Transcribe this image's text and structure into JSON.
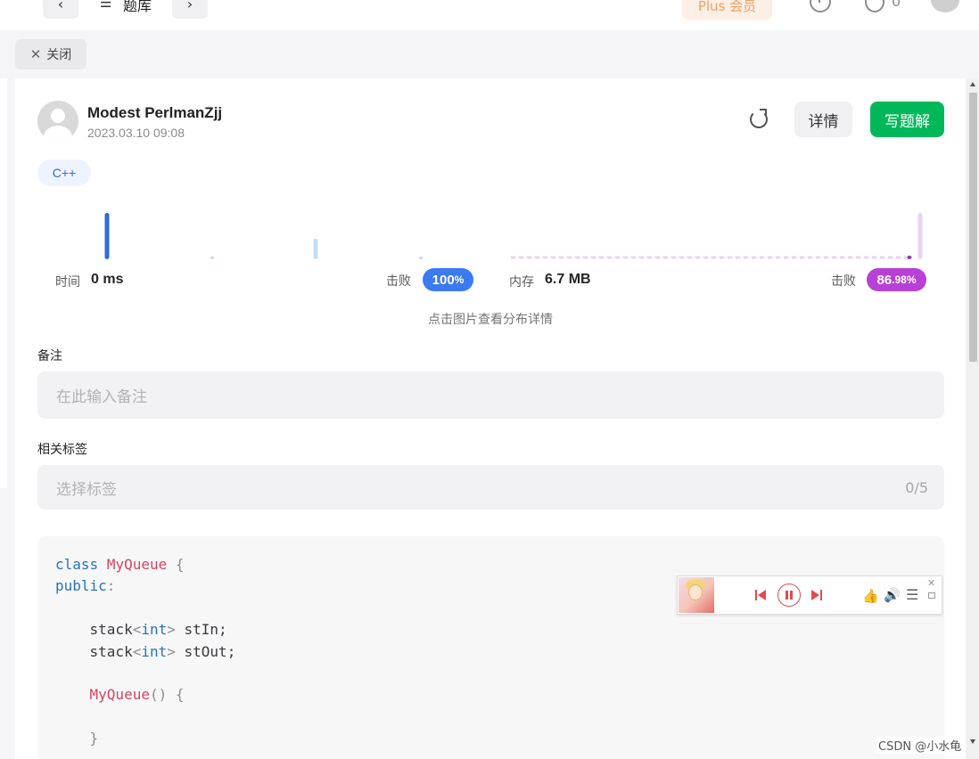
{
  "topbar": {
    "library_label": "题库",
    "prev_glyph": "‹",
    "next_glyph": "›",
    "list_glyph": "☰",
    "plus_label": "Plus 会员",
    "streak_count": "0"
  },
  "close_button": {
    "label": "关闭",
    "glyph": "✕"
  },
  "solution": {
    "author": "Modest PerlmanZjj",
    "date": "2023.03.10 09:08",
    "detail_label": "详情",
    "write_label": "写题解",
    "language_tag": "C++"
  },
  "stats": {
    "time_label": "时间",
    "time_value": "0 ms",
    "time_beat_label": "击败",
    "time_beat_value": "100",
    "time_beat_unit": "%",
    "memory_label": "内存",
    "memory_value": "6.7 MB",
    "memory_beat_label": "击败",
    "memory_beat_int": "86",
    "memory_beat_frac": ".98%",
    "hint": "点击图片查看分布详情"
  },
  "chart_data": [
    {
      "type": "bar",
      "categories": [
        "0",
        "1",
        "2",
        "3"
      ],
      "values": [
        100,
        4,
        45,
        4
      ],
      "highlight_index": 0,
      "colors": {
        "highlight": "#2f6be0",
        "other": "#c9dcf7"
      }
    },
    {
      "type": "bar",
      "categories": [
        "0",
        "1"
      ],
      "values": [
        100,
        8
      ],
      "highlight_index": 1,
      "colors": {
        "highlight": "#8e3bb5",
        "other": "#ead3f7"
      }
    }
  ],
  "notes": {
    "label": "备注",
    "placeholder": "在此输入备注"
  },
  "tags": {
    "label": "相关标签",
    "placeholder": "选择标签",
    "count": "0/5"
  },
  "code": {
    "lines": [
      [
        {
          "t": "class",
          "c": "kw"
        },
        {
          "t": " ",
          "c": "var"
        },
        {
          "t": "MyQueue",
          "c": "cls"
        },
        {
          "t": " {",
          "c": "punc"
        }
      ],
      [
        {
          "t": "public",
          "c": "kw"
        },
        {
          "t": ":",
          "c": "punc"
        }
      ],
      [],
      [
        {
          "t": "    stack",
          "c": "var"
        },
        {
          "t": "<",
          "c": "punc"
        },
        {
          "t": "int",
          "c": "kw"
        },
        {
          "t": ">",
          "c": "punc"
        },
        {
          "t": " stIn;",
          "c": "var"
        }
      ],
      [
        {
          "t": "    stack",
          "c": "var"
        },
        {
          "t": "<",
          "c": "punc"
        },
        {
          "t": "int",
          "c": "kw"
        },
        {
          "t": ">",
          "c": "punc"
        },
        {
          "t": " stOut;",
          "c": "var"
        }
      ],
      [],
      [
        {
          "t": "    ",
          "c": "var"
        },
        {
          "t": "MyQueue",
          "c": "cls"
        },
        {
          "t": "() {",
          "c": "punc"
        }
      ],
      [],
      [
        {
          "t": "    }",
          "c": "punc"
        }
      ]
    ]
  },
  "player": {
    "like_glyph": "👍",
    "volume_glyph": "🔊",
    "playlist_glyph": "☰",
    "close_glyph": "✕"
  },
  "watermark": "CSDN @小水龟"
}
